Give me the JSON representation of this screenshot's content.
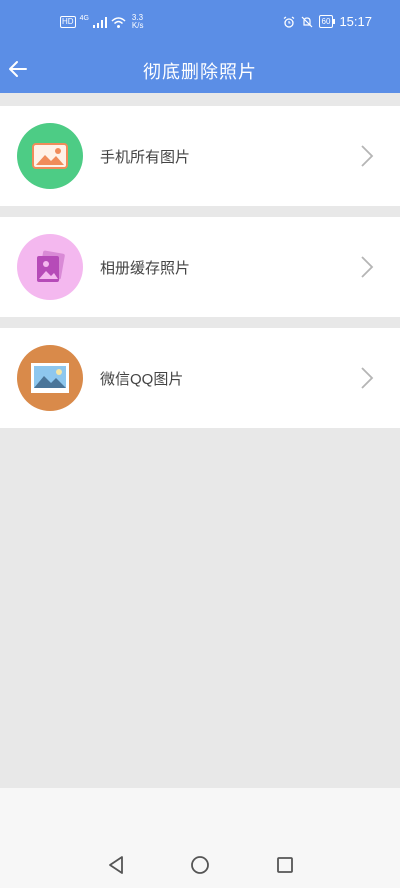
{
  "status_bar": {
    "hd": "HD",
    "net_type": "4G",
    "speed_value": "3.3",
    "speed_unit": "K/s",
    "battery": "60",
    "time": "15:17"
  },
  "header": {
    "title": "彻底删除照片",
    "back_icon": "arrow-left-icon",
    "color": "#5b8ee6"
  },
  "items": [
    {
      "label": "手机所有图片",
      "icon": "phone-photos-icon",
      "color": "#4dcc85"
    },
    {
      "label": "相册缓存照片",
      "icon": "album-cache-icon",
      "color": "#f4b8ef"
    },
    {
      "label": "微信QQ图片",
      "icon": "wechat-qq-photo-icon",
      "color": "#d98a4a"
    }
  ],
  "nav": {
    "back_icon": "triangle-back-icon",
    "home_icon": "circle-home-icon",
    "recent_icon": "square-recent-icon"
  }
}
